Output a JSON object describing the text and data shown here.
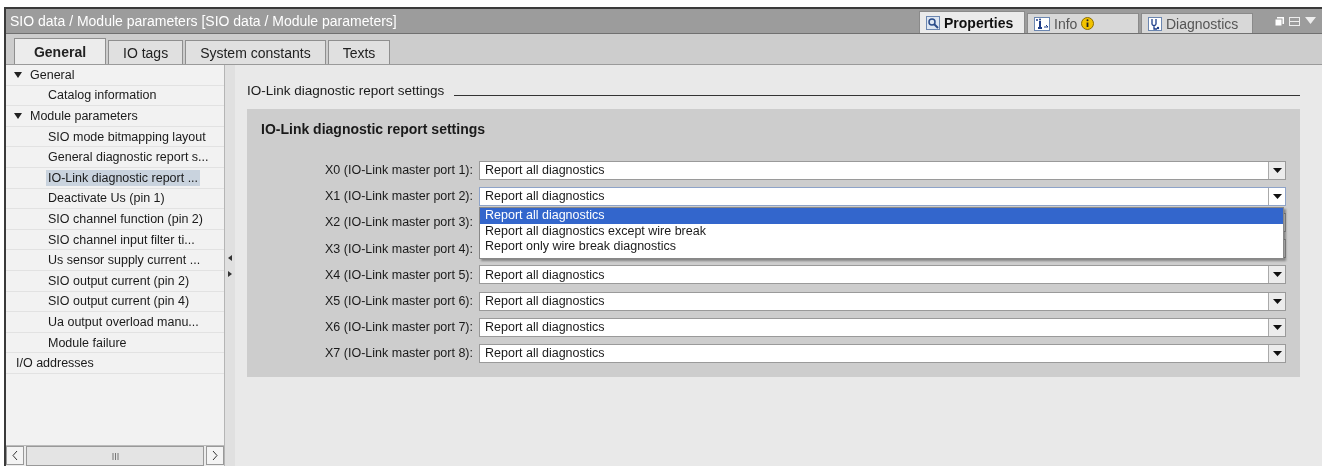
{
  "window": {
    "title": "SIO data / Module parameters [SIO data / Module parameters]"
  },
  "inspector_tabs": [
    {
      "label": "Properties",
      "selected": true,
      "kind": "properties"
    },
    {
      "label": "Info",
      "selected": false,
      "kind": "info"
    },
    {
      "label": "Diagnostics",
      "selected": false,
      "kind": "diagnostics"
    }
  ],
  "tabs": [
    {
      "label": "General",
      "selected": true
    },
    {
      "label": "IO tags",
      "selected": false
    },
    {
      "label": "System constants",
      "selected": false
    },
    {
      "label": "Texts",
      "selected": false
    }
  ],
  "tree": [
    {
      "label": "General",
      "expanded": true,
      "selected": false,
      "children": [
        {
          "label": "Catalog information",
          "selected": false
        }
      ]
    },
    {
      "label": "Module parameters",
      "expanded": true,
      "selected": false,
      "children": [
        {
          "label": "SIO mode bitmapping layout",
          "selected": false
        },
        {
          "label": "General diagnostic report s...",
          "selected": false
        },
        {
          "label": "IO-Link diagnostic report ...",
          "selected": true
        },
        {
          "label": "Deactivate Us (pin 1)",
          "selected": false
        },
        {
          "label": "SIO channel function (pin 2)",
          "selected": false
        },
        {
          "label": "SIO channel input filter ti...",
          "selected": false
        },
        {
          "label": "Us sensor supply current ...",
          "selected": false
        },
        {
          "label": "SIO output current (pin 2)",
          "selected": false
        },
        {
          "label": "SIO output current (pin 4)",
          "selected": false
        },
        {
          "label": "Ua output overload manu...",
          "selected": false
        },
        {
          "label": "Module failure",
          "selected": false
        }
      ]
    },
    {
      "label": "I/O addresses",
      "selected": false
    }
  ],
  "section": {
    "title": "IO-Link diagnostic report settings"
  },
  "group": {
    "title": "IO-Link diagnostic report settings",
    "fields": [
      {
        "label": "X0 (IO-Link master port 1):",
        "value": "Report all diagnostics",
        "expanded": false
      },
      {
        "label": "X1 (IO-Link master port 2):",
        "value": "Report all diagnostics",
        "expanded": true,
        "options": [
          {
            "label": "Report all diagnostics",
            "selected": true
          },
          {
            "label": "Report all diagnostics except wire break",
            "selected": false
          },
          {
            "label": "Report only wire break diagnostics",
            "selected": false
          }
        ]
      },
      {
        "label": "X2 (IO-Link master port 3):",
        "expanded": false
      },
      {
        "label": "X3 (IO-Link master port 4):",
        "expanded": false
      },
      {
        "label": "X4 (IO-Link master port 5):",
        "value": "Report all diagnostics",
        "expanded": false
      },
      {
        "label": "X5 (IO-Link master port 6):",
        "value": "Report all diagnostics",
        "expanded": false
      },
      {
        "label": "X6 (IO-Link master port 7):",
        "value": "Report all diagnostics",
        "expanded": false
      },
      {
        "label": "X7 (IO-Link master port 8):",
        "value": "Report all diagnostics",
        "expanded": false
      }
    ]
  }
}
